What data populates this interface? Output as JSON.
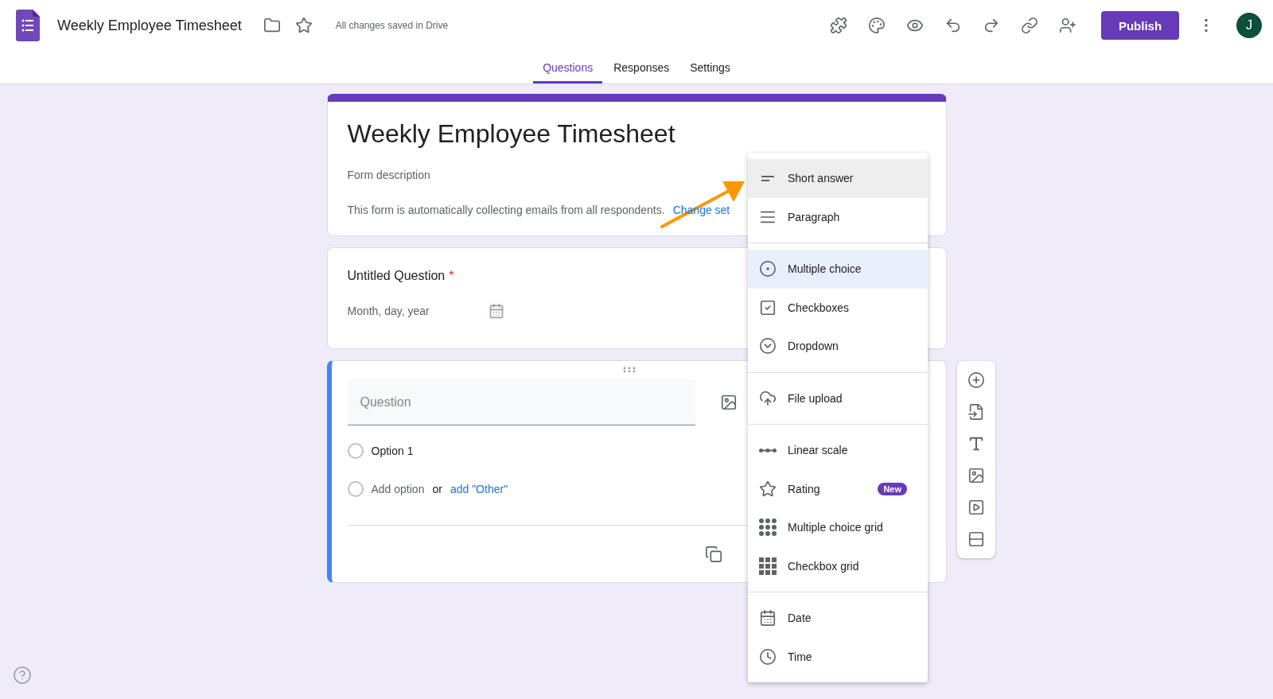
{
  "app": {
    "title": "Weekly Employee Timesheet",
    "save_status": "All changes saved in Drive",
    "publish_button": "Publish",
    "avatar_initial": "J"
  },
  "tabs": [
    {
      "label": "Questions",
      "selected": true
    },
    {
      "label": "Responses",
      "selected": false
    },
    {
      "label": "Settings",
      "selected": false
    }
  ],
  "form_header": {
    "title": "Weekly Employee Timesheet",
    "description_placeholder": "Form description",
    "email_notice": "This form is automatically collecting emails from all respondents.",
    "email_link": "Change set"
  },
  "questions": [
    {
      "kind": "date",
      "active": false,
      "title": "Untitled Question",
      "required_mark": "*",
      "placeholder": "Month, day, year"
    },
    {
      "kind": "choice",
      "active": true,
      "title_placeholder": "Question",
      "options": [
        "Option 1"
      ],
      "add_option": "Add option",
      "or": "or",
      "add_other": "add \"Other\""
    }
  ],
  "type_menu": {
    "groups": [
      [
        {
          "kind": "short_answer",
          "label": "Short answer",
          "highlighted": true,
          "selected": false
        },
        {
          "kind": "paragraph",
          "label": "Paragraph",
          "highlighted": false,
          "selected": false
        }
      ],
      [
        {
          "kind": "multiple_choice",
          "label": "Multiple choice",
          "highlighted": false,
          "selected": true
        },
        {
          "kind": "checkboxes",
          "label": "Checkboxes",
          "highlighted": false,
          "selected": false
        },
        {
          "kind": "dropdown",
          "label": "Dropdown",
          "highlighted": false,
          "selected": false
        }
      ],
      [
        {
          "kind": "file_upload",
          "label": "File upload",
          "highlighted": false,
          "selected": false
        }
      ],
      [
        {
          "kind": "linear_scale",
          "label": "Linear scale",
          "highlighted": false,
          "selected": false
        },
        {
          "kind": "rating",
          "label": "Rating",
          "badge": "New",
          "highlighted": false,
          "selected": false
        },
        {
          "kind": "mc_grid",
          "label": "Multiple choice grid",
          "highlighted": false,
          "selected": false
        },
        {
          "kind": "checkbox_grid",
          "label": "Checkbox grid",
          "highlighted": false,
          "selected": false
        }
      ],
      [
        {
          "kind": "date",
          "label": "Date",
          "highlighted": false,
          "selected": false
        },
        {
          "kind": "time",
          "label": "Time",
          "highlighted": false,
          "selected": false
        }
      ]
    ]
  }
}
